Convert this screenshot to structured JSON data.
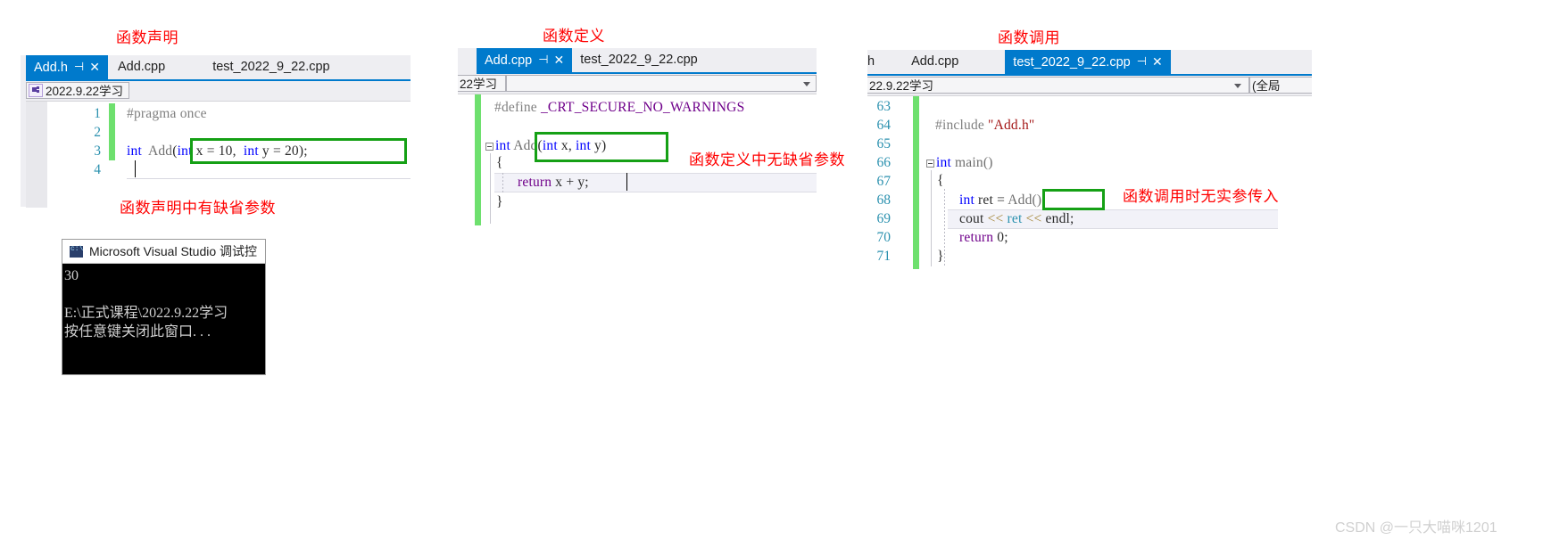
{
  "annotations": {
    "panel1_title": "函数声明",
    "panel1_note": "函数声明中有缺省参数",
    "panel2_title": "函数定义",
    "panel2_note": "函数定义中无缺省参数",
    "panel3_title": "函数调用",
    "panel3_note": "函数调用时无实参传入"
  },
  "panel1": {
    "tabs": [
      {
        "label": "Add.h",
        "active": true,
        "pin": "⊣",
        "close": "✕"
      },
      {
        "label": "Add.cpp",
        "active": false
      },
      {
        "label": "test_2022_9_22.cpp",
        "active": false
      }
    ],
    "nav": {
      "project": "2022.9.22学习"
    },
    "line_numbers": [
      "1",
      "2",
      "3",
      "4"
    ],
    "code": {
      "l1": "#pragma once",
      "l3_a": "int",
      "l3_b": "Add",
      "l3_c": "(",
      "l3_d": "int",
      "l3_e": " x = ",
      "l3_f": "10",
      "l3_g": ",  ",
      "l3_h": "int",
      "l3_i": " y = ",
      "l3_j": "20",
      "l3_k": ");"
    }
  },
  "console": {
    "title": "Microsoft Visual Studio 调试控",
    "line1": "30",
    "line2": "E:\\正式课程\\2022.9.22学习",
    "line3": "按任意键关闭此窗口. . ."
  },
  "panel2": {
    "tabs": [
      {
        "label": "Add.cpp",
        "active": true,
        "pin": "⊣",
        "close": "✕"
      },
      {
        "label": "test_2022_9_22.cpp",
        "active": false
      }
    ],
    "nav": {
      "project": "22学习"
    },
    "code": {
      "l1_a": "#define",
      "l1_b": " _CRT_SECURE_NO_WARNINGS",
      "l3_a": "int",
      "l3_b": " Add",
      "l3_c": "(",
      "l3_d": "int",
      "l3_e": " x, ",
      "l3_f": "int",
      "l3_g": " y)",
      "l4": "{",
      "l5_a": "return",
      "l5_b": " x + y;",
      "l6": "}"
    }
  },
  "panel3": {
    "tabs": [
      {
        "label": "h",
        "active": false
      },
      {
        "label": "Add.cpp",
        "active": false
      },
      {
        "label": "test_2022_9_22.cpp",
        "active": true,
        "pin": "⊣",
        "close": "✕"
      }
    ],
    "nav": {
      "project": "22.9.22学习",
      "scope": "(全局"
    },
    "line_numbers": [
      "63",
      "64",
      "65",
      "66",
      "67",
      "68",
      "69",
      "70",
      "71"
    ],
    "code": {
      "l64_a": "#include",
      "l64_b": " \"Add.h\"",
      "l66_a": "int",
      "l66_b": " main()",
      "l67": "{",
      "l68_a": "int",
      "l68_b": " ret = ",
      "l68_c": "Add();",
      "l69_a": "cout",
      "l69_b": " << ",
      "l69_c": "ret",
      "l69_d": " << ",
      "l69_e": "endl;",
      "l70_a": "return",
      "l70_b": " 0;",
      "l71": "}"
    }
  },
  "watermark": {
    "text": "CSDN @一只大喵咪1201"
  },
  "colors": {
    "accent_blue": "#007acc",
    "annotation_red": "#ff0000",
    "highlight_green": "#15a015",
    "changebar_green": "#6ee06e",
    "linenumber_blue": "#2b91af"
  }
}
